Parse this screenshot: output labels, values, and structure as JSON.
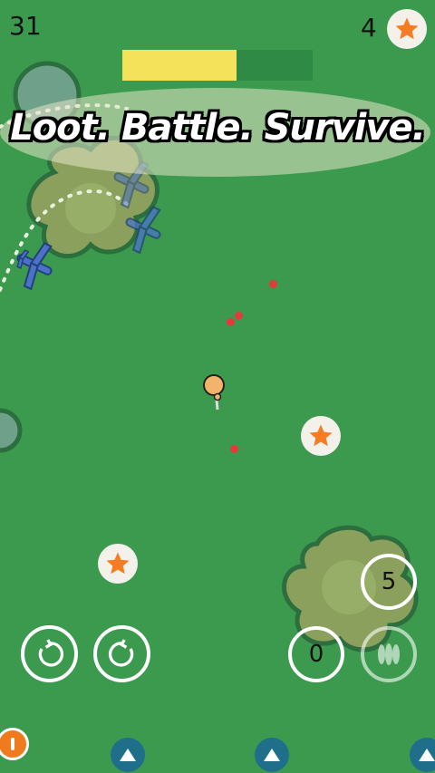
{
  "hud": {
    "kill_count": "31",
    "star_count": "4",
    "health_fraction": 0.6
  },
  "banner": {
    "text": "Loot. Battle. Survive."
  },
  "controls": {
    "ammo_count": "0",
    "grenade_count": "5",
    "rotate_left_icon": "rotate-ccw-icon",
    "rotate_right_icon": "rotate-cw-icon",
    "bullets_icon": "bullets-icon"
  },
  "colors": {
    "grass": "#3b9a4e",
    "bush": "#5f9a4f",
    "health": "#f4e35a",
    "star": "#f57c22",
    "plane": "#4a72c8",
    "enemy_dot": "#e43a3a",
    "nav_button": "#1f6f8b"
  }
}
